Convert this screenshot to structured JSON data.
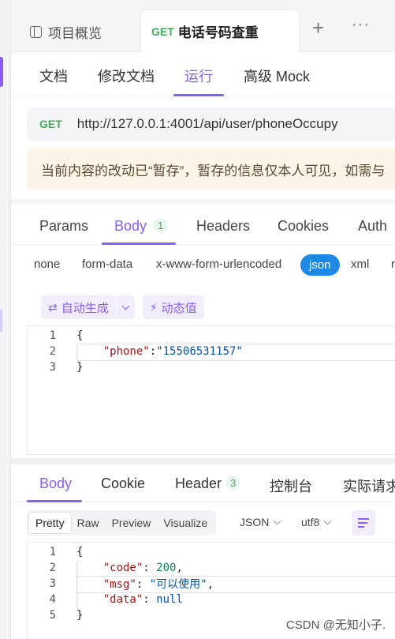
{
  "tabs": {
    "overview": "项目概览",
    "active_method": "GET",
    "active_title": "电话号码查重",
    "add": "+",
    "more": "···"
  },
  "subnav": [
    "文档",
    "修改文档",
    "运行",
    "高级 Mock"
  ],
  "request": {
    "method": "GET",
    "url": "http://127.0.0.1:4001/api/user/phoneOccupy",
    "notice": "当前内容的改动已“暂存”，暂存的信息仅本人可见，如需与"
  },
  "param_tabs": {
    "params": "Params",
    "body": "Body",
    "body_count": "1",
    "headers": "Headers",
    "cookies": "Cookies",
    "auth": "Auth"
  },
  "body_types": [
    "none",
    "form-data",
    "x-www-form-urlencoded",
    "json",
    "xml",
    "r"
  ],
  "tools": {
    "auto": "自动生成",
    "dynamic": "动态值"
  },
  "request_body": {
    "lines": [
      "1",
      "2",
      "3"
    ],
    "open": "{",
    "key": "\"phone\"",
    "colon": ":",
    "value": "\"15506531157\"",
    "close": "}"
  },
  "response_tabs": {
    "body": "Body",
    "cookie": "Cookie",
    "header": "Header",
    "header_count": "3",
    "console": "控制台",
    "actual": "实际请求"
  },
  "view": {
    "modes": [
      "Pretty",
      "Raw",
      "Preview",
      "Visualize"
    ],
    "format": "JSON",
    "encoding": "utf8"
  },
  "response_body": {
    "lines": [
      "1",
      "2",
      "3",
      "4",
      "5"
    ],
    "open": "{",
    "k1": "\"code\"",
    "v1": "200",
    "k2": "\"msg\"",
    "v2": "\"可以使用\"",
    "k3": "\"data\"",
    "v3": "null",
    "close": "}"
  },
  "watermark": "CSDN @无知小子."
}
